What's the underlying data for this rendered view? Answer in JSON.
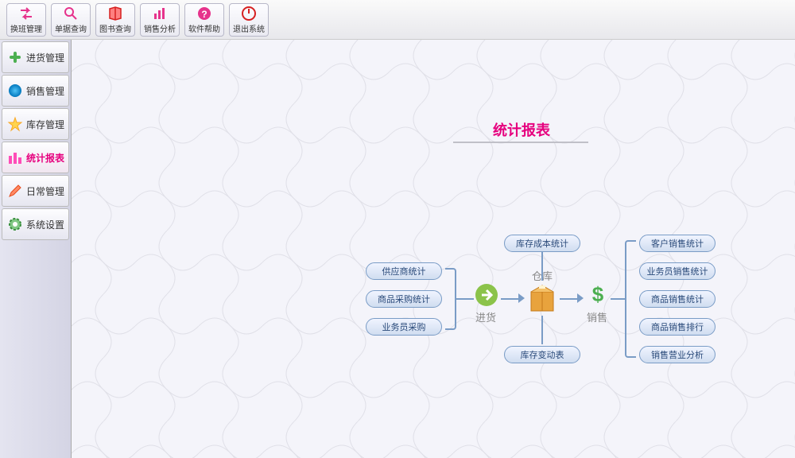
{
  "toolbar": [
    {
      "label": "换班管理",
      "icon": "swap"
    },
    {
      "label": "单据查询",
      "icon": "search"
    },
    {
      "label": "图书查询",
      "icon": "book"
    },
    {
      "label": "销售分析",
      "icon": "chart"
    },
    {
      "label": "软件帮助",
      "icon": "help"
    },
    {
      "label": "退出系统",
      "icon": "exit"
    }
  ],
  "sidebar": [
    {
      "label": "进货管理",
      "icon": "plus",
      "active": false
    },
    {
      "label": "销售管理",
      "icon": "ball",
      "active": false
    },
    {
      "label": "库存管理",
      "icon": "star",
      "active": false
    },
    {
      "label": "统计报表",
      "icon": "bars",
      "active": true
    },
    {
      "label": "日常管理",
      "icon": "pencil",
      "active": false
    },
    {
      "label": "系统设置",
      "icon": "gear",
      "active": false
    }
  ],
  "page_title": "统计报表",
  "diagram": {
    "left_group": [
      "供应商统计",
      "商品采购统计",
      "业务员采购"
    ],
    "top_node": "库存成本统计",
    "bottom_node": "库存变动表",
    "right_group": [
      "客户销售统计",
      "业务员销售统计",
      "商品销售统计",
      "商品销售排行",
      "销售营业分析"
    ],
    "center_labels": {
      "purchase": "进货",
      "warehouse": "仓库",
      "sales": "销售"
    }
  }
}
